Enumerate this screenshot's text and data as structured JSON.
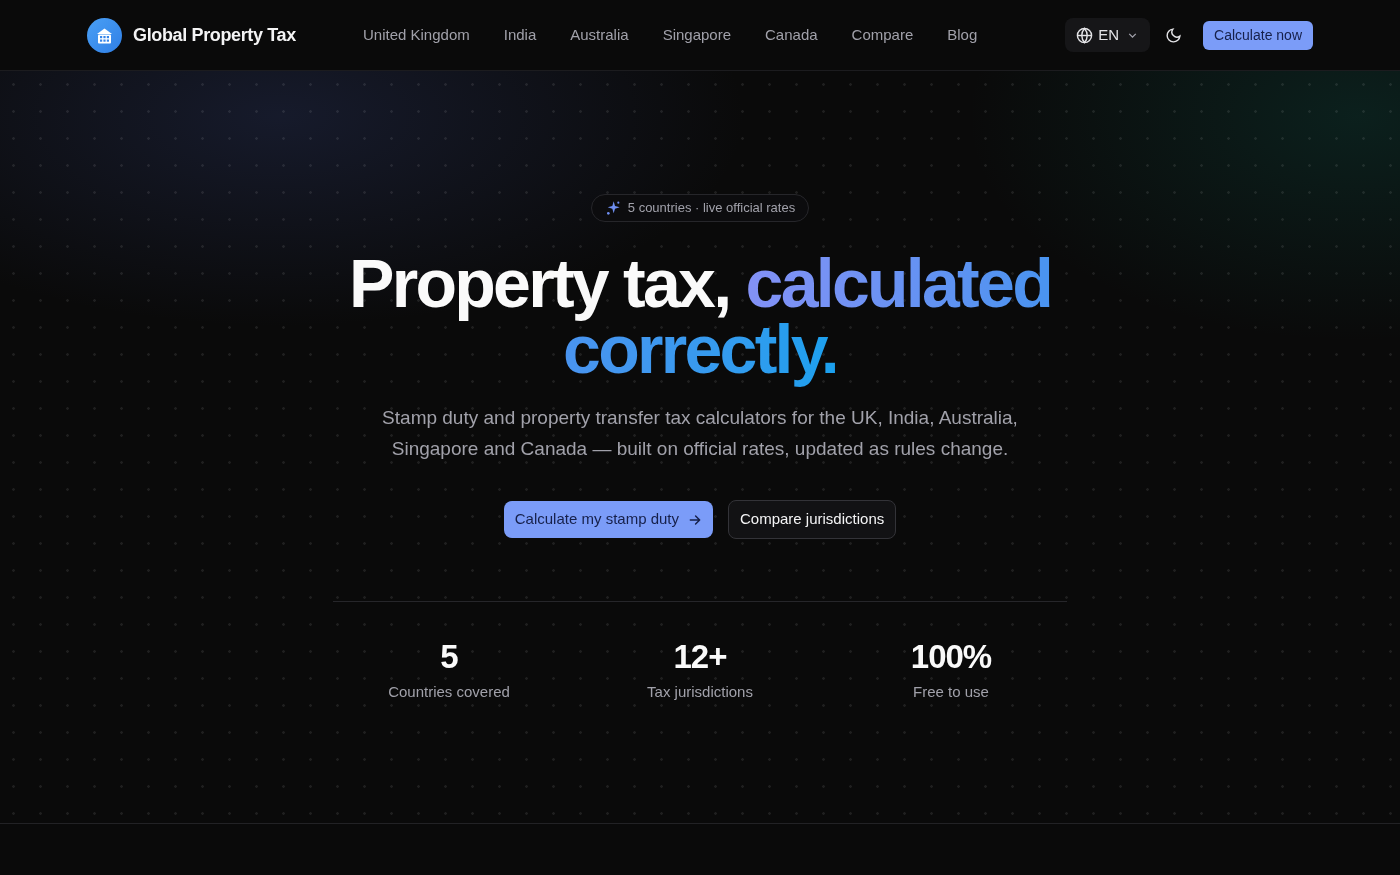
{
  "header": {
    "brand": "Global Property Tax",
    "nav_links": [
      "United Kingdom",
      "India",
      "Australia",
      "Singapore",
      "Canada",
      "Compare",
      "Blog"
    ],
    "language": "EN",
    "cta": "Calculate now"
  },
  "hero": {
    "badge": "5 countries · live official rates",
    "heading": {
      "text": "Property tax,",
      "accent": "calculated correctly."
    },
    "subtitle": "Stamp duty and property transfer tax calculators for the UK, India, Australia, Singapore and Canada — built on official rates, updated as rules change.",
    "buttons": [
      {
        "label": "Calculate my stamp duty",
        "kind": "primary"
      },
      {
        "label": "Compare jurisdictions",
        "kind": "secondary"
      }
    ],
    "stats": [
      {
        "value": "5",
        "label": "Countries covered"
      },
      {
        "value": "12+",
        "label": "Tax jurisdictions"
      },
      {
        "value": "100%",
        "label": "Free to use"
      }
    ]
  }
}
